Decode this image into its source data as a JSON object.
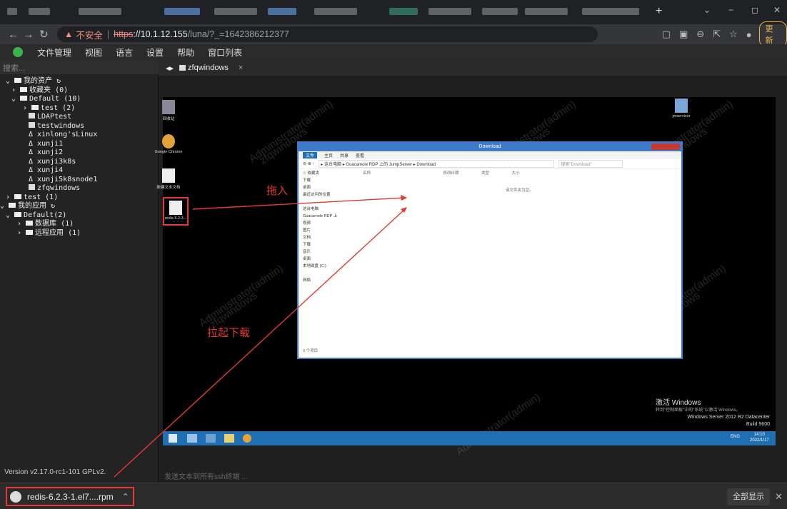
{
  "browser": {
    "url_warning": "不安全",
    "url_scheme": "https",
    "url_host": "://10.1.12.155",
    "url_path": "/luna/?_=1642386212377",
    "update_label": "更新",
    "window_buttons": [
      "⌄",
      "−",
      "◻",
      "✕"
    ]
  },
  "menu": [
    "文件管理",
    "视图",
    "语言",
    "设置",
    "帮助",
    "窗口列表"
  ],
  "sidebar": {
    "search_placeholder": "搜索...",
    "assets_label": "我的资产",
    "favorites": "收藏夹 (0)",
    "default_group": "Default (10)",
    "test_group": "test (2)",
    "items": [
      "LDAPtest",
      "testwindows",
      "xinlong'sLinux",
      "xunji1",
      "xunji2",
      "xunji3k8s",
      "xunji4",
      "xunji5k8snode1",
      "zfqwindows"
    ],
    "test_top": "test (1)",
    "apps_label": "我的应用",
    "app_default": "Default(2)",
    "db": "数据库 (1)",
    "remote_app": "远程应用 (1)",
    "version": "Version v2.17.0-rc1-101 GPLv2."
  },
  "session": {
    "tab_label": "zfqwindows",
    "send_placeholder": "发送文本到所有ssh终端 ..."
  },
  "remote": {
    "desktop_icons": [
      "回收站",
      "Google Chrome",
      "新建文本文档",
      "redis-6.2.3..."
    ],
    "jms_icon": "jmservisor",
    "watermark_user": "Administrator(admin)",
    "watermark_asset": "zfqwindows",
    "explorer_title": "Download",
    "explorer_ribbon": [
      "文件",
      "主页",
      "共享",
      "查看"
    ],
    "explorer_path": "▸ 这台电脑 ▸ Guacamole RDP 上的 JumpServer ▸ Download",
    "explorer_search": "搜索\"Download\"",
    "nav_items": [
      "☆ 收藏夹",
      "下载",
      "桌面",
      "最近访问的位置",
      "",
      "这台电脑",
      "Guacamole RDP 上",
      "视频",
      "图片",
      "文档",
      "下载",
      "音乐",
      "桌面",
      "本地磁盘 (C:)",
      "",
      "网络"
    ],
    "columns": [
      "名称",
      "修改日期",
      "类型",
      "大小"
    ],
    "empty_text": "该文件夹为空。",
    "item_count": "0 个项目",
    "activate_title": "激活 Windows",
    "activate_hint": "转到\"控制面板\"中的\"系统\"以激活 Windows。",
    "os_name": "Windows Server 2012 R2 Datacenter",
    "build": "Build 9600",
    "tray_lang": "ENG",
    "tray_time": "14:10",
    "tray_date": "2022/1/17"
  },
  "annotations": {
    "drag_in": "拖入",
    "pull_download": "拉起下载"
  },
  "downloads": {
    "file": "redis-6.2.3-1.el7....rpm",
    "show_all": "全部显示"
  },
  "colors": {
    "annotation_red": "#e53935",
    "explorer_blue": "#3f79c8",
    "taskbar_blue": "#1f6fb2"
  }
}
